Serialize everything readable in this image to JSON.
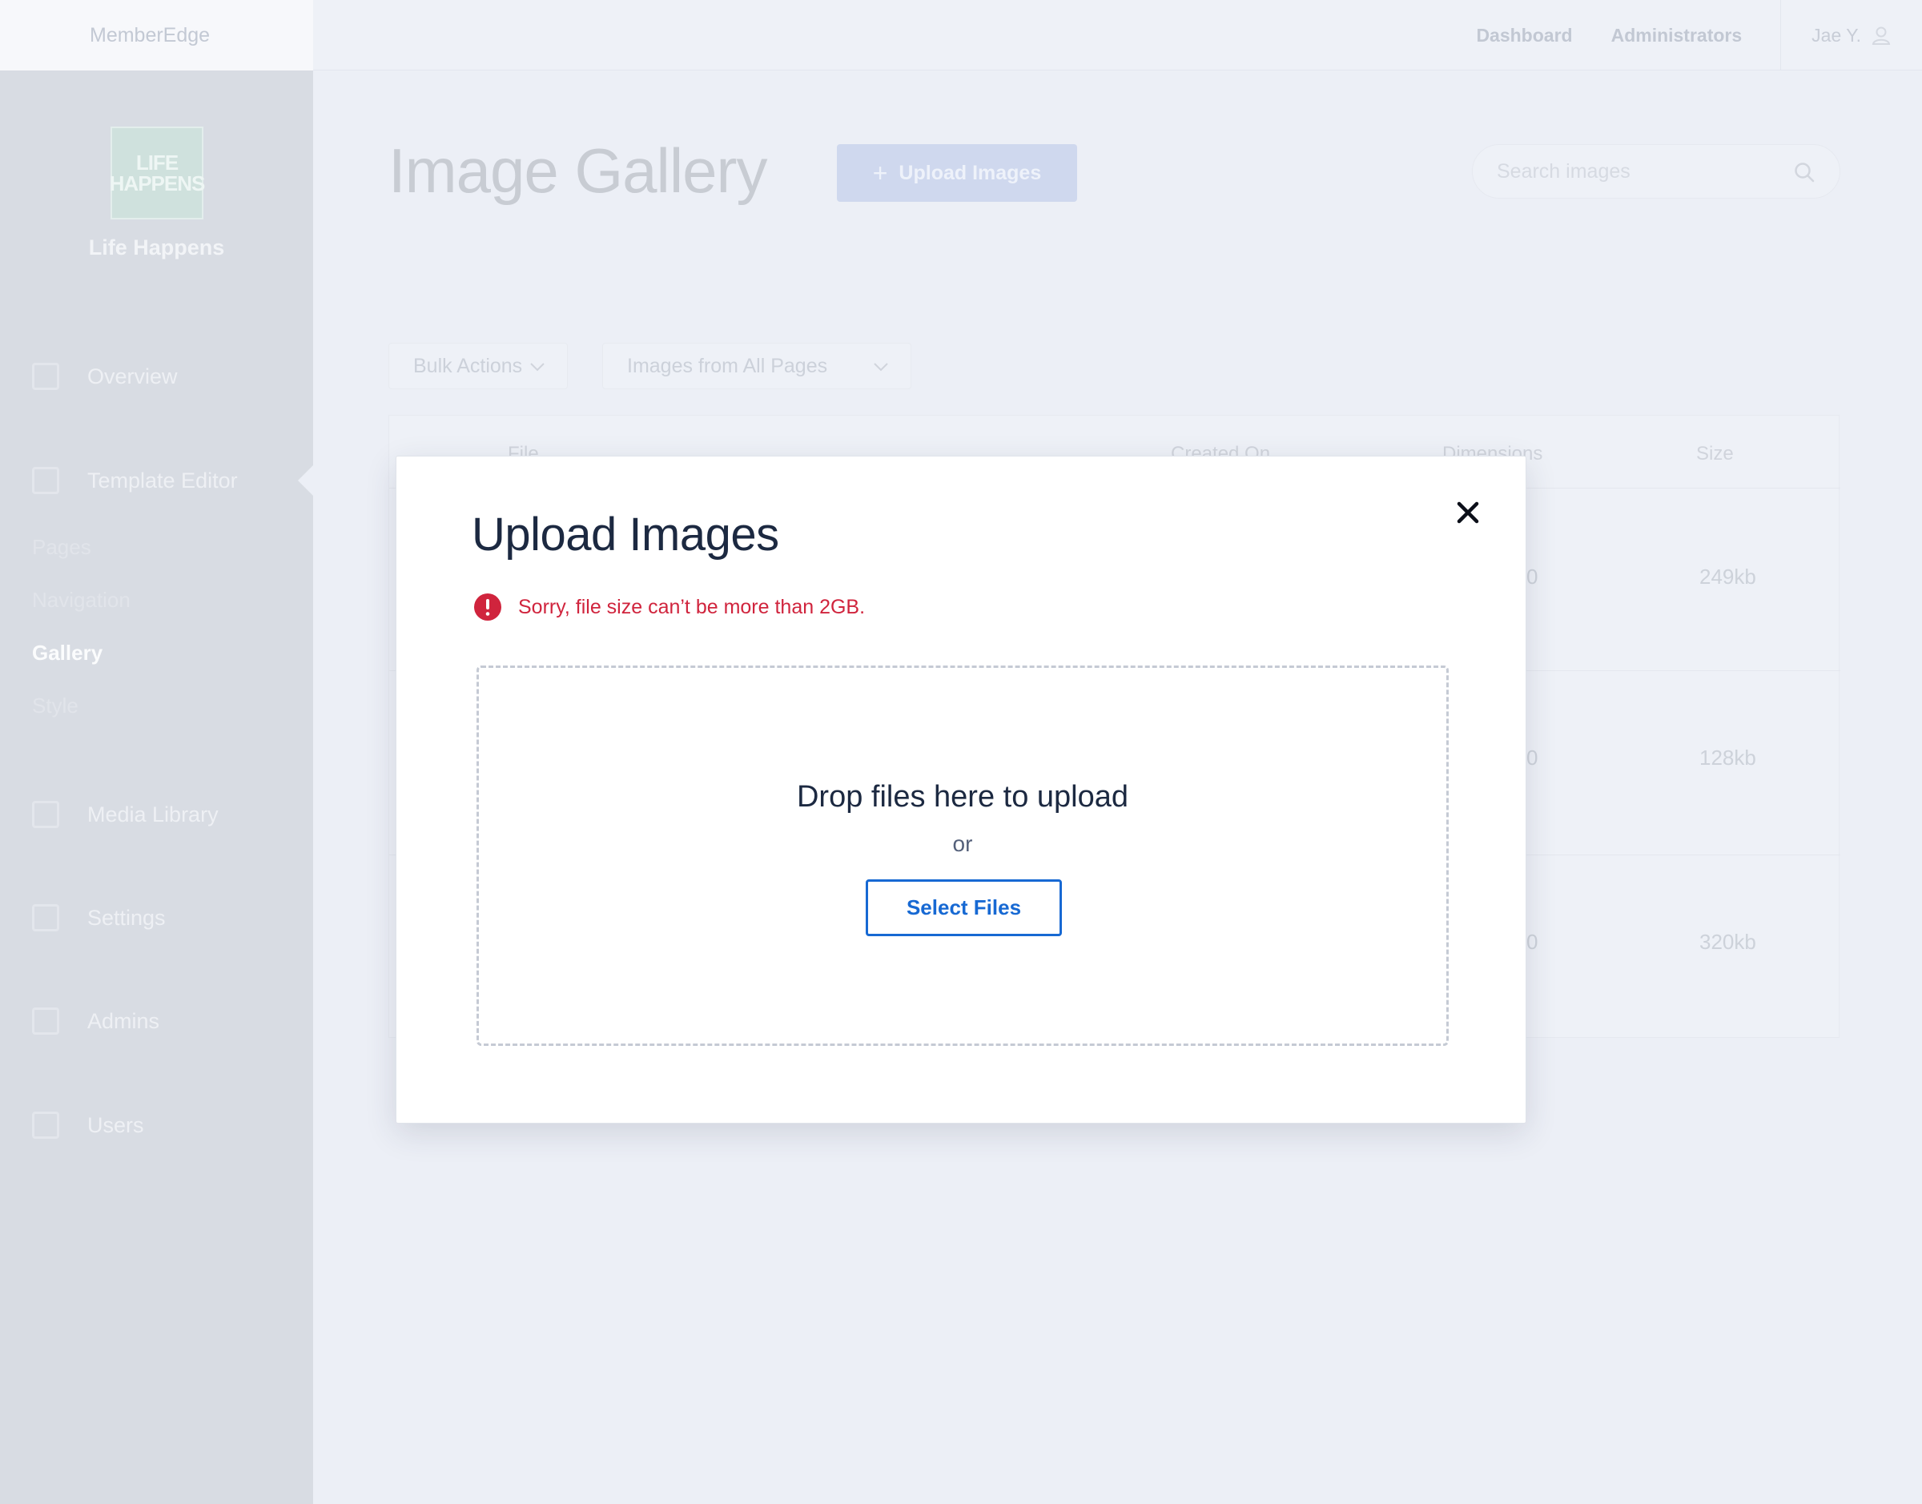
{
  "app": {
    "brand": "MemberEdge",
    "nav": [
      "Dashboard",
      "Administrators"
    ],
    "user_name": "Jae Y."
  },
  "sidebar": {
    "logo_lines": [
      "LIFE",
      "HAPPENS"
    ],
    "org_name": "Life Happens",
    "items": [
      {
        "label": "Overview",
        "icon": "overview-icon"
      },
      {
        "label": "Template Editor",
        "icon": "template-icon"
      },
      {
        "label": "Media Library",
        "icon": "media-icon"
      },
      {
        "label": "Settings",
        "icon": "settings-icon"
      },
      {
        "label": "Admins",
        "icon": "admins-icon"
      },
      {
        "label": "Users",
        "icon": "users-icon"
      }
    ],
    "subitems": [
      "Pages",
      "Navigation",
      "Gallery",
      "Style"
    ],
    "active_subitem": "Gallery"
  },
  "page": {
    "title": "Image Gallery",
    "upload_button": "Upload Images",
    "search_placeholder": "Search images",
    "bulk_actions": "Bulk Actions",
    "filter": "Images from All Pages",
    "table": {
      "headers": [
        "File",
        "Created On",
        "Dimensions",
        "Size"
      ],
      "rows": [
        {
          "dimensions_partial": "0",
          "size": "249kb"
        },
        {
          "dimensions_partial": "0",
          "size": "128kb"
        },
        {
          "dimensions_partial": "0",
          "size": "320kb"
        }
      ]
    }
  },
  "modal": {
    "title": "Upload Images",
    "error": "Sorry, file size can’t be more than 2GB.",
    "drop_text": "Drop files here to upload",
    "or_text": "or",
    "select_button": "Select Files"
  },
  "colors": {
    "accent": "#1769d3",
    "error": "#d0243d",
    "text_dark": "#1c2941"
  }
}
